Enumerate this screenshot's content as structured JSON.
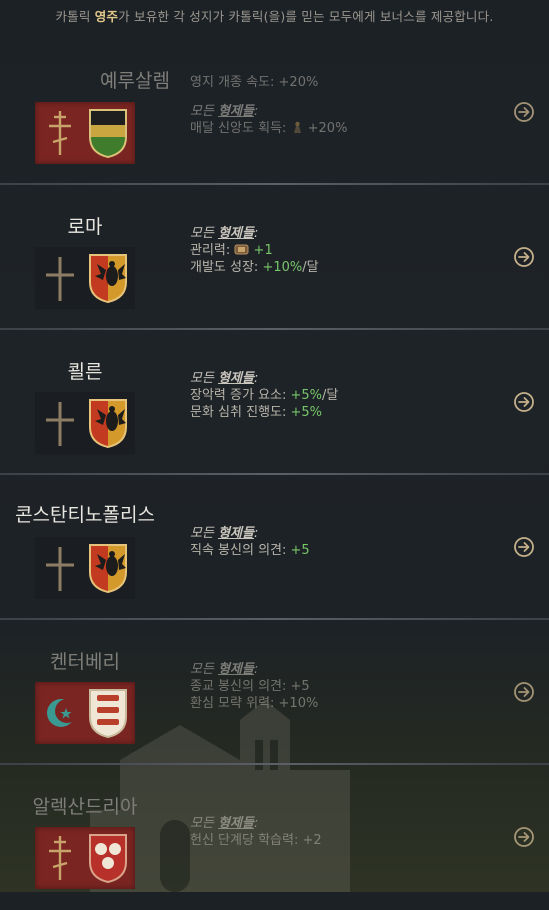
{
  "header": {
    "prefix": "카톨릭 ",
    "highlight": "영주",
    "suffix": "가 보유한 각 성지가 카톨릭(을)를 믿는 모두에게 보너스를 제공합니다."
  },
  "colors": {
    "red_box": "#7a2522",
    "gold": "#e2c98a",
    "green": "#78c66a"
  },
  "holy_sites": [
    {
      "name": "예루살렘",
      "held": false,
      "faith_icon": "orthodox-cross-icon",
      "coa_icon": "black-yellow-green-shield-icon",
      "lines": [
        {
          "plain": "영지 개종 속도: +20%"
        },
        {
          "header_prefix": "모든 ",
          "header_emph": "형제들",
          "header_suffix": ":"
        },
        {
          "plain": "매달 신앙도 획득: ",
          "icon": "piety-icon",
          "value": "+20%"
        }
      ]
    },
    {
      "name": "로마",
      "held": true,
      "faith_icon": "latin-cross-icon",
      "coa_icon": "eagle-shield-icon",
      "lines": [
        {
          "header_prefix": "모든 ",
          "header_emph": "형제들",
          "header_suffix": ":"
        },
        {
          "plain": "관리력: ",
          "icon": "stewardship-icon",
          "value": "+1"
        },
        {
          "plain": "개발도 성장: ",
          "value": "+10%",
          "tail": "/달"
        }
      ]
    },
    {
      "name": "쾰른",
      "held": true,
      "faith_icon": "latin-cross-icon",
      "coa_icon": "eagle-shield-icon",
      "lines": [
        {
          "header_prefix": "모든 ",
          "header_emph": "형제들",
          "header_suffix": ":"
        },
        {
          "plain": "장악력 증가 요소: ",
          "value": "+5%",
          "tail": "/달"
        },
        {
          "plain": "문화 심취 진행도: ",
          "value": "+5%"
        }
      ]
    },
    {
      "name": "콘스탄티노폴리스",
      "held": true,
      "faith_icon": "latin-cross-icon",
      "coa_icon": "eagle-shield-icon",
      "lines": [
        {
          "header_prefix": "모든 ",
          "header_emph": "형제들",
          "header_suffix": ":"
        },
        {
          "plain": "직속 봉신의 의견: ",
          "value": "+5"
        }
      ]
    },
    {
      "name": "켄터베리",
      "held": false,
      "faith_icon": "crescent-star-icon",
      "coa_icon": "lions-shield-icon",
      "lines": [
        {
          "header_prefix": "모든 ",
          "header_emph": "형제들",
          "header_suffix": ":"
        },
        {
          "plain": "종교 봉신의 의견: +5"
        },
        {
          "plain": "환심 모략 위력: +10%"
        }
      ]
    },
    {
      "name": "알렉산드리아",
      "held": false,
      "faith_icon": "orthodox-cross-icon",
      "coa_icon": "three-roundels-shield-icon",
      "lines": [
        {
          "header_prefix": "모든 ",
          "header_emph": "형제들",
          "header_suffix": ":"
        },
        {
          "plain": "헌신 단계당 학습력: +2"
        }
      ]
    }
  ]
}
